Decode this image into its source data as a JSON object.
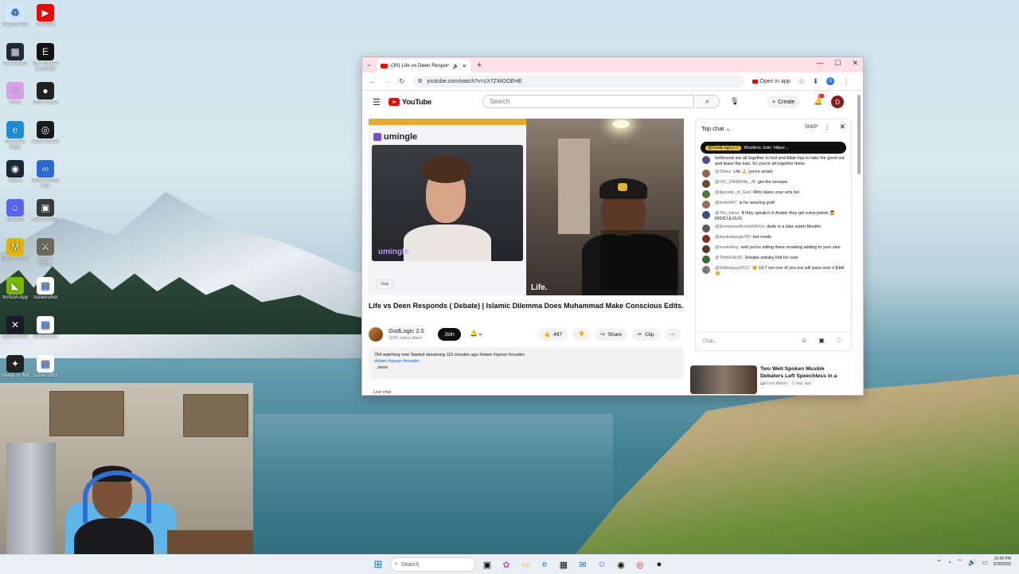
{
  "desktop_icons": [
    {
      "label": "Recycle Bin",
      "color": "#cfe7ff",
      "glyph": "♻"
    },
    {
      "label": "YouTube",
      "color": "#ff0000",
      "glyph": "▶"
    },
    {
      "label": "Streamlabs",
      "color": "#1f2b36",
      "glyph": "▦"
    },
    {
      "label": "Epic Games Launcher",
      "color": "#111111",
      "glyph": "E"
    },
    {
      "label": "Paint",
      "color": "#d9a0e8",
      "glyph": "✎"
    },
    {
      "label": "OBS Studio",
      "color": "#222222",
      "glyph": "●"
    },
    {
      "label": "Microsoft Edge",
      "color": "#1b8fd6",
      "glyph": "e"
    },
    {
      "label": "Razer Cortex",
      "color": "#1a1a1a",
      "glyph": "◎"
    },
    {
      "label": "Steam",
      "color": "#1b2838",
      "glyph": "◉"
    },
    {
      "label": "Meta Horizon Link",
      "color": "#2a6ad8",
      "glyph": "∞"
    },
    {
      "label": "Discord",
      "color": "#5865f2",
      "glyph": "☺"
    },
    {
      "label": "Half Life Alyx",
      "color": "#3a3a3a",
      "glyph": "▣"
    },
    {
      "label": "Marvel Rivals",
      "color": "#e0b400",
      "glyph": "M"
    },
    {
      "label": "War of Rights",
      "color": "#6a6a5a",
      "glyph": "⚔"
    },
    {
      "label": "NVIDIA App",
      "color": "#76b900",
      "glyph": "◣"
    },
    {
      "label": "Screenshot",
      "color": "#ffffff",
      "glyph": "▤"
    },
    {
      "label": "Halo Infinite",
      "color": "#1a1a2a",
      "glyph": "✕"
    },
    {
      "label": "Screenshot",
      "color": "#ffffff",
      "glyph": "▤"
    },
    {
      "label": "Ready or Not",
      "color": "#222222",
      "glyph": "✦"
    },
    {
      "label": "Screenshot",
      "color": "#ffffff",
      "glyph": "▤"
    }
  ],
  "browser": {
    "tab_title": "(30) Life vs Deen Responds",
    "url": "youtube.com/watch?v=zX7ZWGOEHE",
    "open_in_app": "Open in app",
    "profile_initial": "D"
  },
  "youtube": {
    "logo": "YouTube",
    "search_placeholder": "Search",
    "create": "Create",
    "notif_badge": "9+",
    "avatar_initial": "D",
    "video": {
      "umingle_label": "umingle",
      "watermark": "umingle",
      "stop_label": "Stop",
      "life_label": "Life."
    },
    "title": "Life vs Deen Responds ( Debate) | Islamic Dilemma Does Muhammad Make Conscious Edits.",
    "channel": "GodLogic 2.0",
    "subscribers": "102K subscribers",
    "join": "Join",
    "likes": "497",
    "share": "Share",
    "clip": "Clip",
    "description_meta": "784 watching now  Started streaming 115 minutes ago  #islam #quran #muslim",
    "description_tags": "#islam #quran #muslim",
    "more": "...more",
    "live_chat_label": "Live chat"
  },
  "chat": {
    "header": "Top chat",
    "super": "50KP",
    "pinned_name": "@GodLogic2.0",
    "pinned_text": "Muslims Join: https/...",
    "pre_text": "hellbound are all together in hell and Allah has to take the good out and leave the bad. So you're all together there.",
    "messages": [
      {
        "author": "@2bites",
        "text": "Life 🙏 you're smart",
        "color": "#8a6a4a"
      },
      {
        "author": "@VIC_DAMONE_J8",
        "text": "get the versase",
        "color": "#6a4a2a"
      },
      {
        "author": "@Apostle_of_God",
        "text": "Who takes your sins boi",
        "color": "#4a7a3a"
      },
      {
        "author": "@testis497",
        "text": "is he wearing gold",
        "color": "#9a6a5a"
      },
      {
        "author": "@Tito_bless",
        "text": "If they speak it in Arabic they get extra points 🤦 RIDICULOUS",
        "color": "#3a4a8a"
      },
      {
        "author": "@EmmanuelKoseWithUs",
        "text": "dude is a luke warm Muslim",
        "color": "#5a5a5a"
      },
      {
        "author": "@bankabanga789",
        "text": "bot mode",
        "color": "#8a2a2a"
      },
      {
        "author": "@hosteding",
        "text": "and you're sitting there smoking adding to your sins",
        "color": "#5a3a2a"
      },
      {
        "author": "@TheMulle32",
        "text": "Sneaks sneaky link for sure",
        "color": "#3a6a3a"
      },
      {
        "author": "@DaBadguy2012",
        "text": "😊 19.7 not one of you but will pass over it [Hell 😊",
        "color": "#7a7a7a"
      }
    ],
    "input_placeholder": "Chat..."
  },
  "recommendation": {
    "title": "Two Well Spoken Muslim Debaters Left Speechless in a ...",
    "channel": "Vincent Abbey",
    "meta": "1 day ago"
  },
  "taskbar": {
    "search": "Search",
    "time": "10:49 PM",
    "date": "3/28/2026"
  }
}
